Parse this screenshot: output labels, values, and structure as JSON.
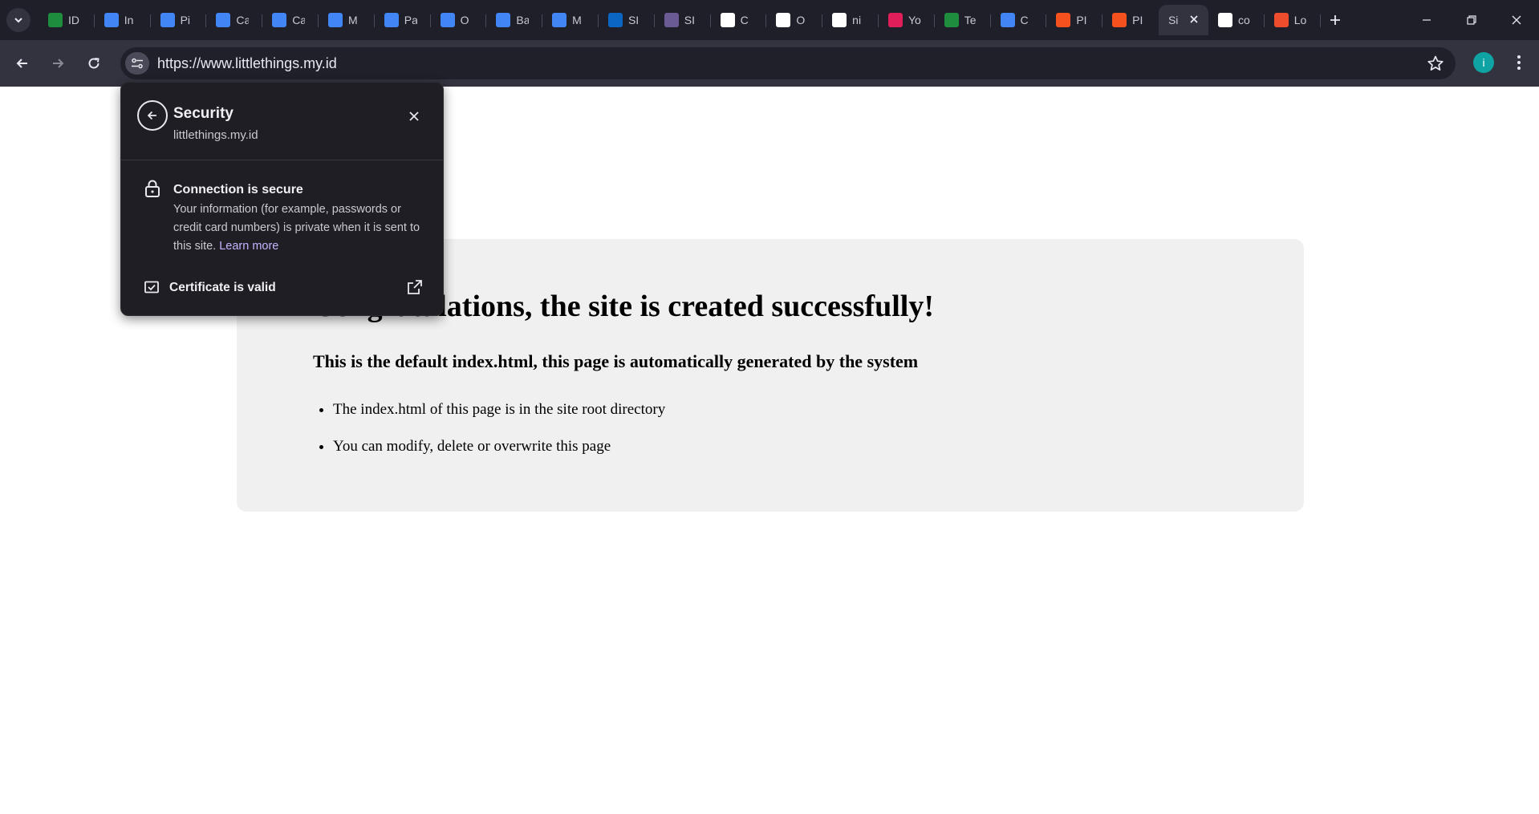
{
  "browser": {
    "tabs": [
      {
        "title": "ID",
        "icon": "sheets-icon",
        "color": "#1e8e3e"
      },
      {
        "title": "In",
        "icon": "docs-icon",
        "color": "#4285f4"
      },
      {
        "title": "Pi",
        "icon": "docs-icon",
        "color": "#4285f4"
      },
      {
        "title": "Ca",
        "icon": "chat-icon",
        "color": "#4285f4"
      },
      {
        "title": "Ca",
        "icon": "docs-icon",
        "color": "#4285f4"
      },
      {
        "title": "M",
        "icon": "docs-icon",
        "color": "#4285f4"
      },
      {
        "title": "Pa",
        "icon": "docs-icon",
        "color": "#4285f4"
      },
      {
        "title": "O",
        "icon": "docs-icon",
        "color": "#4285f4"
      },
      {
        "title": "Ba",
        "icon": "docs-icon",
        "color": "#4285f4"
      },
      {
        "title": "M",
        "icon": "docs-icon",
        "color": "#4285f4"
      },
      {
        "title": "SI",
        "icon": "linkedin-icon",
        "color": "#0a66c2"
      },
      {
        "title": "SI",
        "icon": "globe-icon",
        "color": "#6b5b95"
      },
      {
        "title": "C",
        "icon": "send-icon",
        "color": "#ffffff"
      },
      {
        "title": "O",
        "icon": "cloud-icon",
        "color": "#ffffff"
      },
      {
        "title": "ni",
        "icon": "google-icon",
        "color": "#ffffff"
      },
      {
        "title": "Yo",
        "icon": "slack-icon",
        "color": "#e01e5a"
      },
      {
        "title": "Te",
        "icon": "c-logo-icon",
        "color": "#1e8e3e"
      },
      {
        "title": "C",
        "icon": "docs-icon",
        "color": "#4285f4"
      },
      {
        "title": "PI",
        "icon": "swirl-icon",
        "color": "#f4511e"
      },
      {
        "title": "PI",
        "icon": "swirl-icon",
        "color": "#f4511e"
      },
      {
        "title": "Si",
        "icon": "none",
        "color": "#33333f",
        "active": true
      },
      {
        "title": "co",
        "icon": "google-icon",
        "color": "#ffffff"
      },
      {
        "title": "Lo",
        "icon": "shop-icon",
        "color": "#ee4d2d"
      }
    ],
    "address_url": "https://www.littlethings.my.id",
    "profile_initial": "i",
    "accent": "#0fa3a3"
  },
  "security_popup": {
    "title": "Security",
    "domain": "littlethings.my.id",
    "connection_title": "Connection is secure",
    "connection_desc": "Your information (for example, passwords or credit card numbers) is private when it is sent to this site.",
    "learn_more": "Learn more",
    "certificate_label": "Certificate is valid"
  },
  "page": {
    "heading": "Congratulations, the site is created successfully!",
    "subheading": "This is the default index.html, this page is automatically generated by the system",
    "bullets": [
      "The index.html of this page is in the site root directory",
      "You can modify, delete or overwrite this page"
    ]
  }
}
